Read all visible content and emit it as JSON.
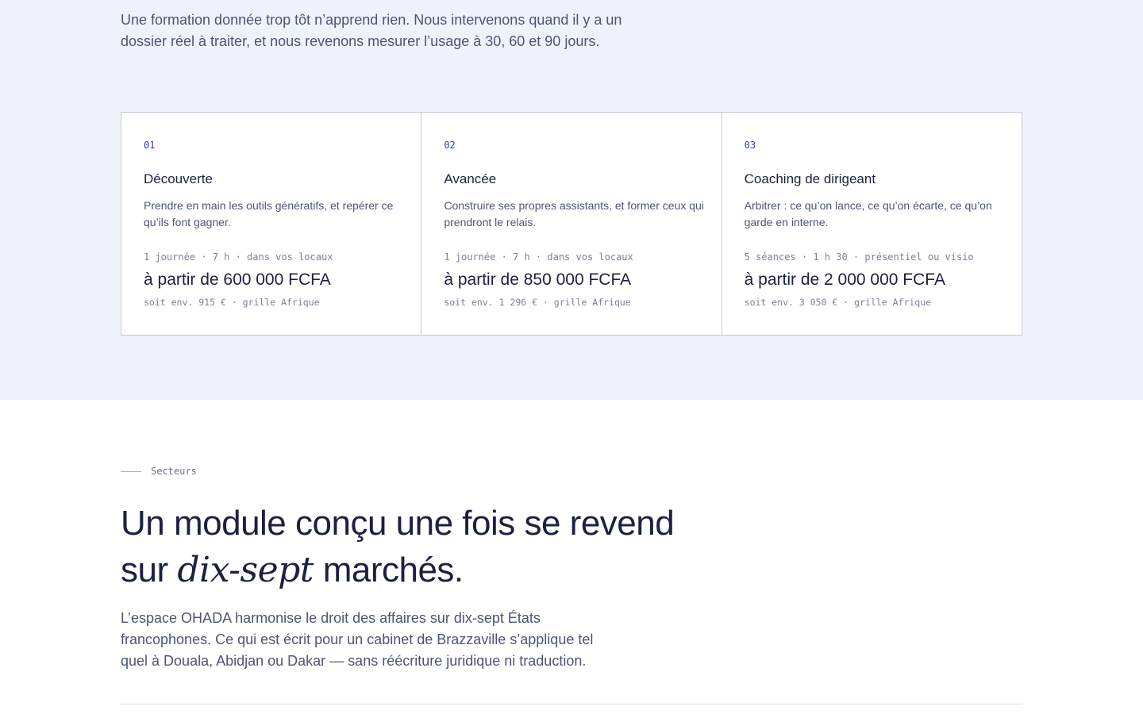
{
  "method": {
    "intro": "Une formation donnée trop tôt n’apprend rien. Nous intervenons quand il y a un dossier réel à traiter, et nous revenons mesurer l’usage à 30, 60 et 90 jours.",
    "offers": [
      {
        "number": "01",
        "title": "Découverte",
        "description": "Prendre en main les outils génératifs, et repérer ce qu’ils font gagner.",
        "meta": "1 journée · 7 h · dans vos locaux",
        "price": "à partir de 600 000 FCFA",
        "price_note": "soit env. 915 € · grille Afrique"
      },
      {
        "number": "02",
        "title": "Avancée",
        "description": "Construire ses propres assistants, et former ceux qui prendront le relais.",
        "meta": "1 journée · 7 h · dans vos locaux",
        "price": "à partir de 850 000 FCFA",
        "price_note": "soit env. 1 296 € · grille Afrique"
      },
      {
        "number": "03",
        "title": "Coaching de dirigeant",
        "description": "Arbitrer : ce qu’on lance, ce qu’on écarte, ce qu’on garde en interne.",
        "meta": "5 séances · 1 h 30 · présentiel ou visio",
        "price": "à partir de 2 000 000 FCFA",
        "price_note": "soit env. 3 050 € · grille Afrique"
      }
    ]
  },
  "sectors": {
    "eyebrow": "Secteurs",
    "headline_part1": "Un module conçu une fois se revend sur ",
    "headline_emphasis": "dix-sept",
    "headline_part2": " marchés.",
    "paragraph": "L’espace OHADA harmonise le droit des affaires sur dix-sept États francophones. Ce qui est écrit pour un cabinet de Brazzaville s’applique tel quel à Douala, Abidjan ou Dakar — sans réécriture juridique ni traduction."
  },
  "colors": {
    "band_background": "#eff2fb",
    "accent": "#2d43b8",
    "text_dark": "#1c2140",
    "text_muted": "#4d5572"
  }
}
